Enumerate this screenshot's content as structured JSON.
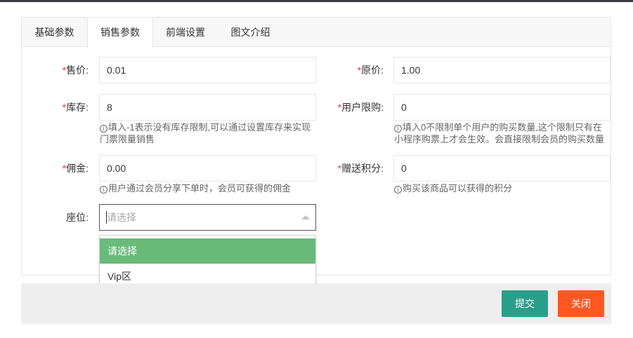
{
  "tabs": [
    {
      "label": "基础参数"
    },
    {
      "label": "销售参数"
    },
    {
      "label": "前端设置"
    },
    {
      "label": "图文介绍"
    }
  ],
  "form": {
    "price": {
      "label": "售价:",
      "value": "0.01"
    },
    "original_price": {
      "label": "原价:",
      "value": "1.00"
    },
    "stock": {
      "label": "库存:",
      "value": "8",
      "help_1": "填入-1表示没有库存限制,可以通过设置库存来实现",
      "help_2": "门票限量销售"
    },
    "user_limit": {
      "label": "用户限购:",
      "value": "0",
      "help_1": "填入0不限制单个用户的购买数量,这个限制只有在",
      "help_2": "小程序购票上才会生效。会直接限制会员的购买数量"
    },
    "commission": {
      "label": "佣金:",
      "value": "0.00",
      "help": "用户通过会员分享下单时，会员可获得的佣金"
    },
    "bonus_points": {
      "label": "赠送积分:",
      "value": "0",
      "help": "购买该商品可以获得的积分"
    },
    "seat": {
      "label": "座位:",
      "placeholder": "请选择",
      "options": [
        "请选择",
        "Vip区"
      ]
    }
  },
  "required_mark": "*",
  "info_glyph": "i",
  "buttons": {
    "submit": "提交",
    "close": "关闭"
  },
  "colors": {
    "primary": "#2b9e8a",
    "danger": "#ff5722",
    "option_selected": "#6aba7a",
    "required": "#ff2d2d"
  }
}
